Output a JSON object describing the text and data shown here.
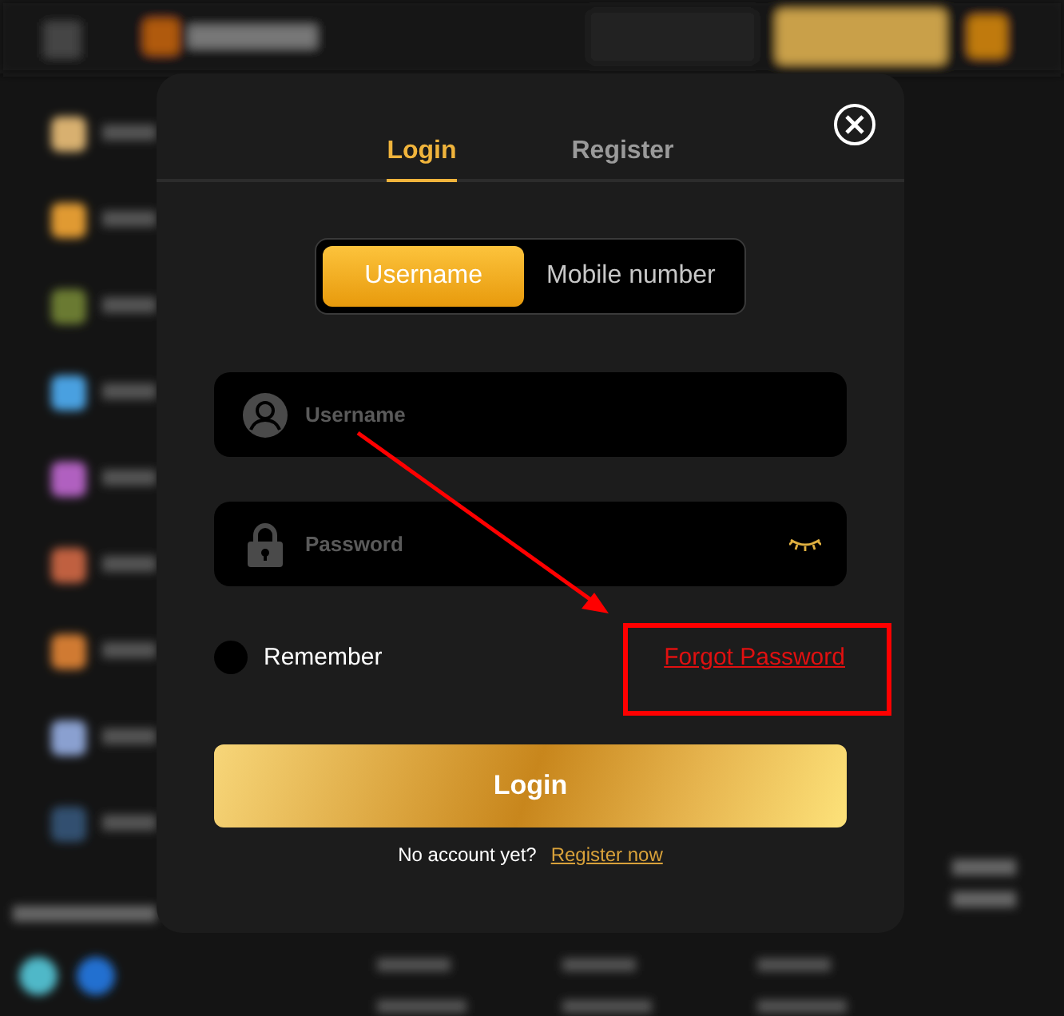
{
  "dialog": {
    "tabs": [
      {
        "label": "Login",
        "selected": true
      },
      {
        "label": "Register",
        "selected": false
      }
    ],
    "method_toggle": [
      {
        "label": "Username",
        "selected": true
      },
      {
        "label": "Mobile number",
        "selected": false
      }
    ],
    "fields": [
      {
        "kind": "text",
        "placeholder": "Username"
      },
      {
        "kind": "password",
        "placeholder": "Password",
        "revealed": false
      }
    ],
    "remember": {
      "label": "Remember",
      "checked": false
    },
    "forgot_link": "Forgot Password",
    "submit": "Login",
    "footer": {
      "text": "No account yet?",
      "link": "Register now"
    }
  },
  "annotations": {
    "arrow": true,
    "highlight_frame": true
  }
}
